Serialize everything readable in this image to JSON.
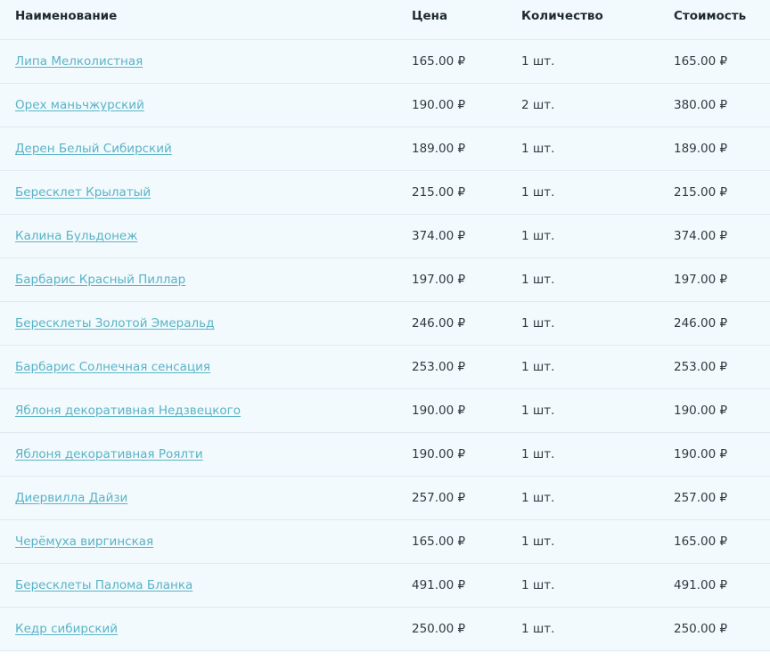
{
  "table": {
    "headers": {
      "name": "Наименование",
      "price": "Цена",
      "quantity": "Количество",
      "total": "Стоимость"
    },
    "rows": [
      {
        "name": "Липа Мелколистная",
        "price": "165.00 ₽",
        "quantity": "1 шт.",
        "total": "165.00 ₽"
      },
      {
        "name": "Орех маньчжурский",
        "price": "190.00 ₽",
        "quantity": "2 шт.",
        "total": "380.00 ₽"
      },
      {
        "name": "Дерен Белый Сибирский",
        "price": "189.00 ₽",
        "quantity": "1 шт.",
        "total": "189.00 ₽"
      },
      {
        "name": "Бересклет Крылатый",
        "price": "215.00 ₽",
        "quantity": "1 шт.",
        "total": "215.00 ₽"
      },
      {
        "name": "Калина Бульдонеж",
        "price": "374.00 ₽",
        "quantity": "1 шт.",
        "total": "374.00 ₽"
      },
      {
        "name": "Барбарис Красный Пиллар",
        "price": "197.00 ₽",
        "quantity": "1 шт.",
        "total": "197.00 ₽"
      },
      {
        "name": "Бересклеты Золотой Эмеральд",
        "price": "246.00 ₽",
        "quantity": "1 шт.",
        "total": "246.00 ₽"
      },
      {
        "name": "Барбарис Солнечная сенсация",
        "price": "253.00 ₽",
        "quantity": "1 шт.",
        "total": "253.00 ₽"
      },
      {
        "name": "Яблоня декоративная Недзвецкого",
        "price": "190.00 ₽",
        "quantity": "1 шт.",
        "total": "190.00 ₽"
      },
      {
        "name": "Яблоня декоративная Роялти",
        "price": "190.00 ₽",
        "quantity": "1 шт.",
        "total": "190.00 ₽"
      },
      {
        "name": "Диервилла Дайзи",
        "price": "257.00 ₽",
        "quantity": "1 шт.",
        "total": "257.00 ₽"
      },
      {
        "name": "Черёмуха виргинская",
        "price": "165.00 ₽",
        "quantity": "1 шт.",
        "total": "165.00 ₽"
      },
      {
        "name": "Бересклеты Палома Бланка",
        "price": "491.00 ₽",
        "quantity": "1 шт.",
        "total": "491.00 ₽"
      },
      {
        "name": "Кедр сибирский",
        "price": "250.00 ₽",
        "quantity": "1 шт.",
        "total": "250.00 ₽"
      }
    ]
  },
  "colors": {
    "background": "#f2fafd",
    "link": "#5ab3c6",
    "text": "#333a3f",
    "divider": "#dfeaef"
  }
}
